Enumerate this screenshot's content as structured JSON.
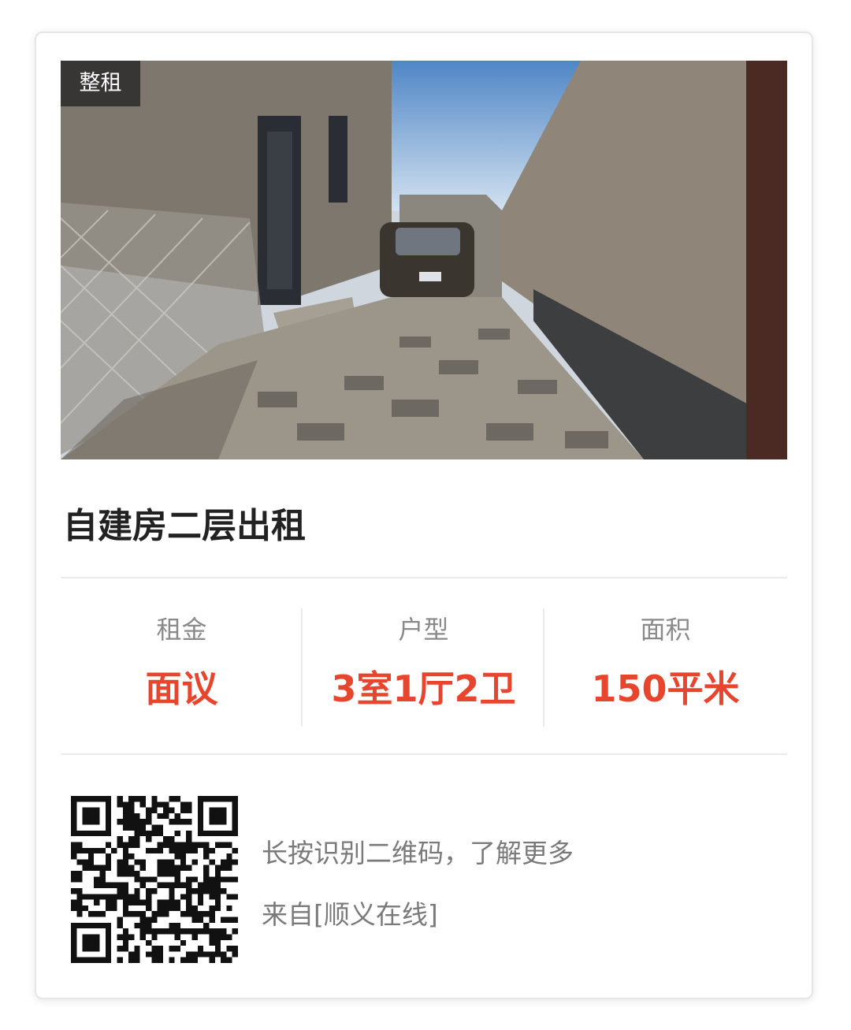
{
  "listing": {
    "tag": "整租",
    "title": "自建房二层出租",
    "photo_icon": "property-photo"
  },
  "stats": [
    {
      "label": "租金",
      "value": "面议"
    },
    {
      "label": "户型",
      "value": "3室1厅2卫"
    },
    {
      "label": "面积",
      "value": "150平米"
    }
  ],
  "footer": {
    "qr_icon": "qr-code-icon",
    "hint": "长按识别二维码，了解更多",
    "source": "来自[顺义在线]"
  },
  "colors": {
    "accent": "#e8452f",
    "label": "#8a8a8a",
    "title": "#222222"
  }
}
